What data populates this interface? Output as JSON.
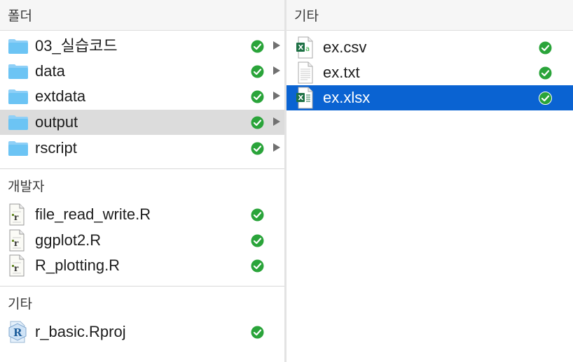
{
  "left": {
    "folders_header": "폴더",
    "folders": [
      {
        "name": "03_실습코드"
      },
      {
        "name": "data"
      },
      {
        "name": "extdata"
      },
      {
        "name": "output"
      },
      {
        "name": "rscript"
      }
    ],
    "developer_header": "개발자",
    "developer_files": [
      {
        "name": "file_read_write.R"
      },
      {
        "name": "ggplot2.R"
      },
      {
        "name": "R_plotting.R"
      }
    ],
    "other_header": "기타",
    "other_files": [
      {
        "name": "r_basic.Rproj"
      }
    ]
  },
  "right": {
    "header": "기타",
    "files": [
      {
        "name": "ex.csv"
      },
      {
        "name": "ex.txt"
      },
      {
        "name": "ex.xlsx"
      }
    ]
  },
  "colors": {
    "selection": "#0a63d2",
    "hover": "#dcdcdc",
    "check_green": "#2aa43a",
    "folder_blue": "#6cc4f4"
  },
  "icons": {
    "folder": "folder-icon",
    "r_script": "r-script-icon",
    "rproj": "rproj-icon",
    "csv": "csv-file-icon",
    "txt": "text-file-icon",
    "xlsx": "excel-file-icon",
    "sync": "check-circle-icon",
    "expand": "disclosure-arrow-icon"
  }
}
